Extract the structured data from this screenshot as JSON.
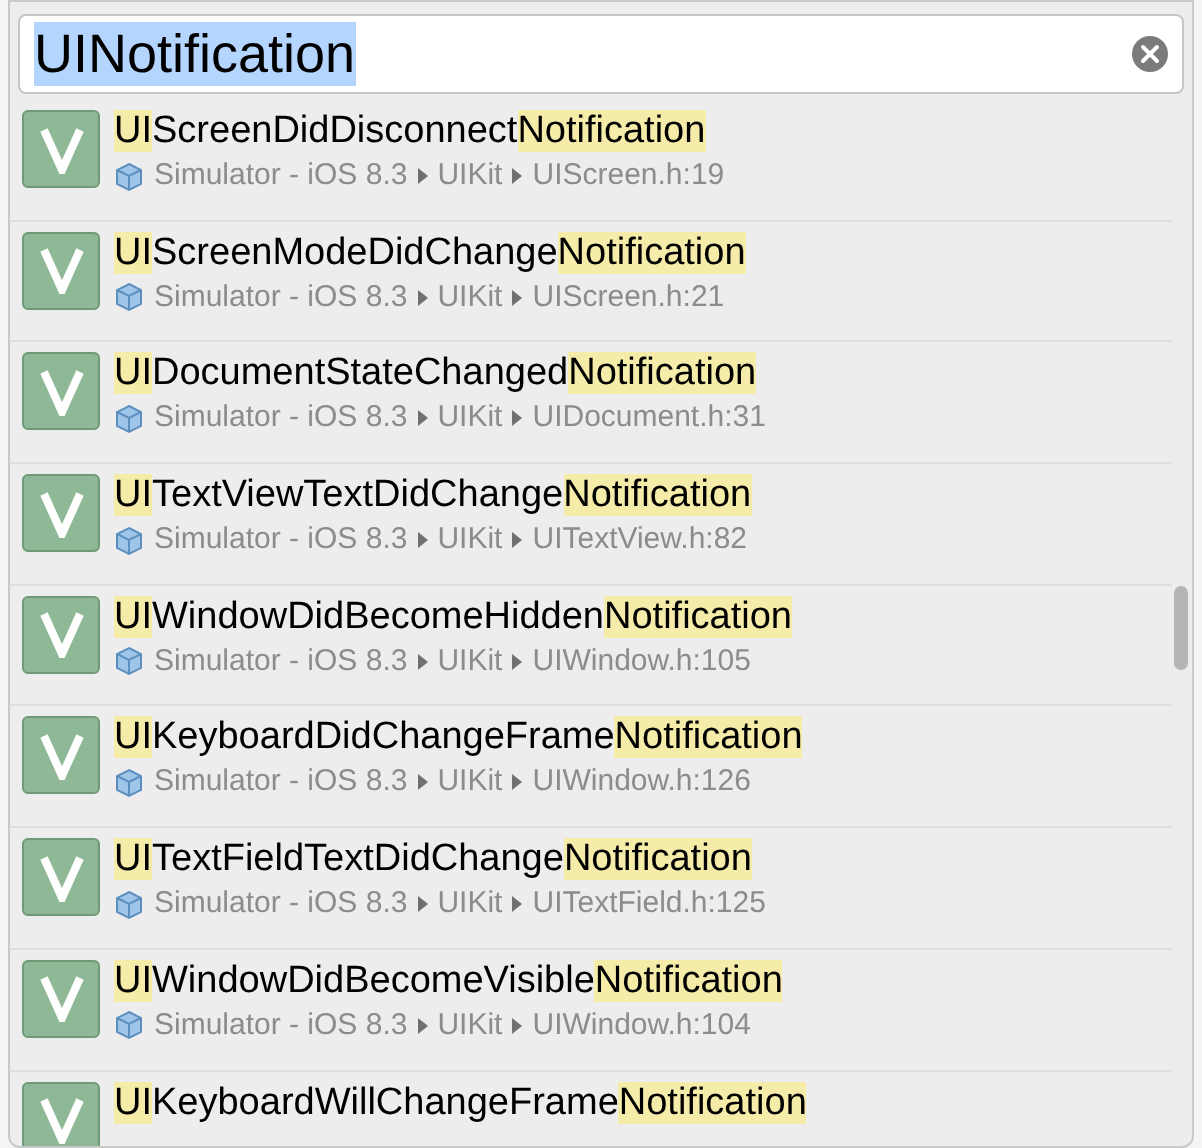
{
  "search": {
    "value": "UINotification",
    "selected": true
  },
  "results": [
    {
      "title_parts": [
        {
          "text": "UI",
          "highlighted": true
        },
        {
          "text": "ScreenDidDisconnect",
          "highlighted": false
        },
        {
          "text": "Notification",
          "highlighted": true
        }
      ],
      "path": [
        "Simulator - iOS 8.3",
        "UIKit",
        "UIScreen.h:19"
      ]
    },
    {
      "title_parts": [
        {
          "text": "UI",
          "highlighted": true
        },
        {
          "text": "ScreenModeDidChange",
          "highlighted": false
        },
        {
          "text": "Notification",
          "highlighted": true
        }
      ],
      "path": [
        "Simulator - iOS 8.3",
        "UIKit",
        "UIScreen.h:21"
      ]
    },
    {
      "title_parts": [
        {
          "text": "UI",
          "highlighted": true
        },
        {
          "text": "DocumentStateChanged",
          "highlighted": false
        },
        {
          "text": "Notification",
          "highlighted": true
        }
      ],
      "path": [
        "Simulator - iOS 8.3",
        "UIKit",
        "UIDocument.h:31"
      ]
    },
    {
      "title_parts": [
        {
          "text": "UI",
          "highlighted": true
        },
        {
          "text": "TextViewTextDidChange",
          "highlighted": false
        },
        {
          "text": "Notification",
          "highlighted": true
        }
      ],
      "path": [
        "Simulator - iOS 8.3",
        "UIKit",
        "UITextView.h:82"
      ]
    },
    {
      "title_parts": [
        {
          "text": "UI",
          "highlighted": true
        },
        {
          "text": "WindowDidBecomeHidden",
          "highlighted": false
        },
        {
          "text": "Notification",
          "highlighted": true
        }
      ],
      "path": [
        "Simulator - iOS 8.3",
        "UIKit",
        "UIWindow.h:105"
      ]
    },
    {
      "title_parts": [
        {
          "text": "UI",
          "highlighted": true
        },
        {
          "text": "KeyboardDidChangeFrame",
          "highlighted": false
        },
        {
          "text": "Notification",
          "highlighted": true
        }
      ],
      "path": [
        "Simulator - iOS 8.3",
        "UIKit",
        "UIWindow.h:126"
      ]
    },
    {
      "title_parts": [
        {
          "text": "UI",
          "highlighted": true
        },
        {
          "text": "TextFieldTextDidChange",
          "highlighted": false
        },
        {
          "text": "Notification",
          "highlighted": true
        }
      ],
      "path": [
        "Simulator - iOS 8.3",
        "UIKit",
        "UITextField.h:125"
      ]
    },
    {
      "title_parts": [
        {
          "text": "UI",
          "highlighted": true
        },
        {
          "text": "WindowDidBecomeVisible",
          "highlighted": false
        },
        {
          "text": "Notification",
          "highlighted": true
        }
      ],
      "path": [
        "Simulator - iOS 8.3",
        "UIKit",
        "UIWindow.h:104"
      ]
    },
    {
      "title_parts": [
        {
          "text": "UI",
          "highlighted": true
        },
        {
          "text": "KeyboardWillChangeFrame",
          "highlighted": false
        },
        {
          "text": "Notification",
          "highlighted": true
        }
      ]
    }
  ]
}
